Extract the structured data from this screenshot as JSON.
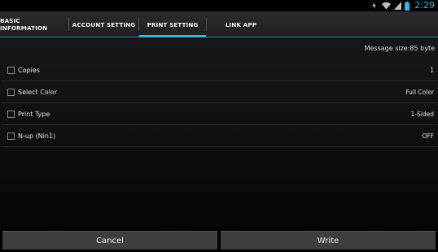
{
  "status_bar": {
    "time": "2:29",
    "icons": [
      "notification-icon",
      "wifi-icon",
      "signal-icon",
      "battery-icon"
    ],
    "clock_color": "#33b5e5"
  },
  "tabs": [
    {
      "label": "BASIC INFORMATION",
      "selected": false
    },
    {
      "label": "ACCOUNT SETTING",
      "selected": false
    },
    {
      "label": "PRINT SETTING",
      "selected": true
    },
    {
      "label": "LINK APP",
      "selected": false
    }
  ],
  "accent_color": "#33b5e5",
  "message_size": "Message size:85 byte",
  "settings": [
    {
      "label": "Copies",
      "value": "1",
      "checked": false
    },
    {
      "label": "Select Color",
      "value": "Full Color",
      "checked": false
    },
    {
      "label": "Print Type",
      "value": "1-Sided",
      "checked": false
    },
    {
      "label": "N-up (Nin1)",
      "value": "OFF",
      "checked": false
    }
  ],
  "buttons": {
    "cancel": "Cancel",
    "write": "Write"
  }
}
